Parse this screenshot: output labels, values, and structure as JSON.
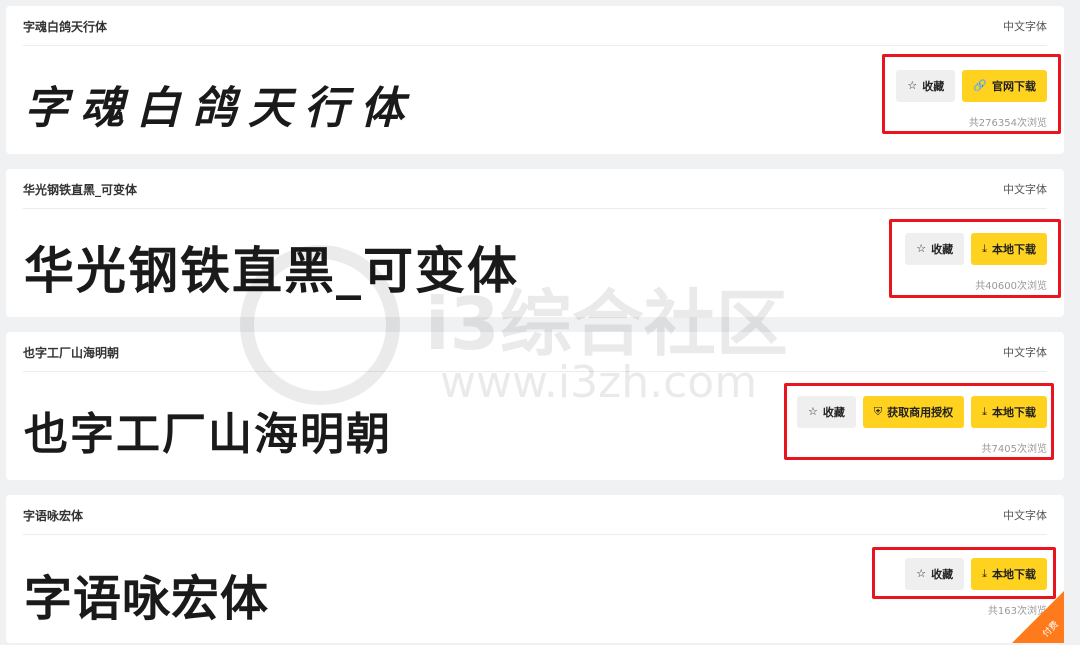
{
  "category_label": "中文字体",
  "fav_label": "收藏",
  "fonts": [
    {
      "name": "字魂白鸽天行体",
      "preview": "字魂白鸽天行体",
      "buttons": {
        "official": "官网下载"
      },
      "views": "共276354次浏览"
    },
    {
      "name": "华光钢铁直黑_可变体",
      "preview": "华光钢铁直黑_可变体",
      "buttons": {
        "local": "本地下载"
      },
      "views": "共40600次浏览"
    },
    {
      "name": "也字工厂山海明朝",
      "preview": "也字工厂山海明朝",
      "buttons": {
        "license": "获取商用授权",
        "local": "本地下载"
      },
      "views": "共7405次浏览"
    },
    {
      "name": "字语咏宏体",
      "preview": "字语咏宏体",
      "buttons": {
        "local": "本地下载"
      },
      "views": "共163次浏览"
    }
  ],
  "watermark": {
    "text": "i3综合社区",
    "url": "www.i3zh.com"
  },
  "paid_badge": "付费",
  "colors": {
    "highlight": "#e8141e",
    "primary_button": "#ffd21f",
    "badge": "#ff7a1a"
  },
  "icons": {
    "fav": "star-icon",
    "official": "link-icon",
    "local": "download-icon",
    "license": "shield-icon"
  }
}
